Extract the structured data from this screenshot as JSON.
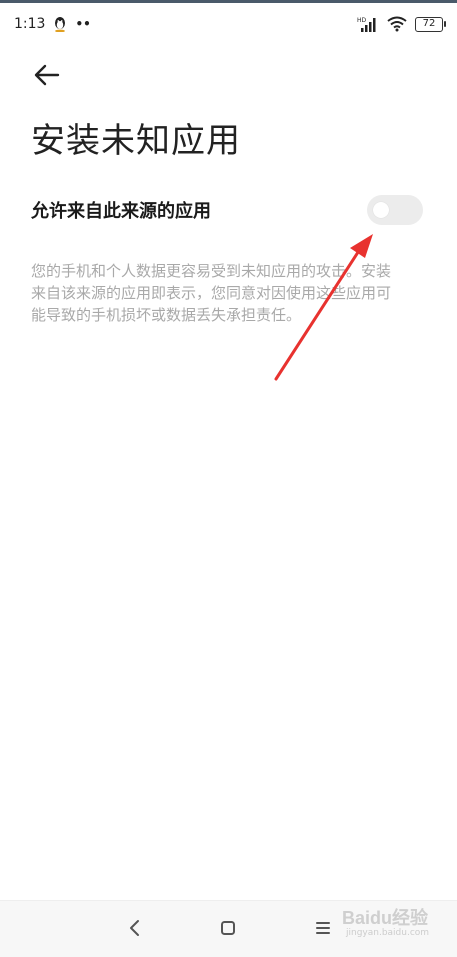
{
  "status_bar": {
    "time": "1:13",
    "notification_dots": "••",
    "network_type": "HD",
    "battery_level": "72"
  },
  "page": {
    "title": "安装未知应用"
  },
  "setting": {
    "label": "允许来自此来源的应用",
    "toggle_on": false,
    "description": "您的手机和个人数据更容易受到未知应用的攻击。安装来自该来源的应用即表示，您同意对因使用这些应用可能导致的手机损坏或数据丢失承担责任。"
  },
  "annotation": {
    "arrow_color": "#e8322f"
  },
  "watermark": {
    "brand": "Baidu经验",
    "url": "jingyan.baidu.com"
  },
  "icons": {
    "back": "arrow-left-icon",
    "nav_back": "chevron-left-icon",
    "nav_home": "square-icon",
    "nav_menu": "menu-icon"
  }
}
